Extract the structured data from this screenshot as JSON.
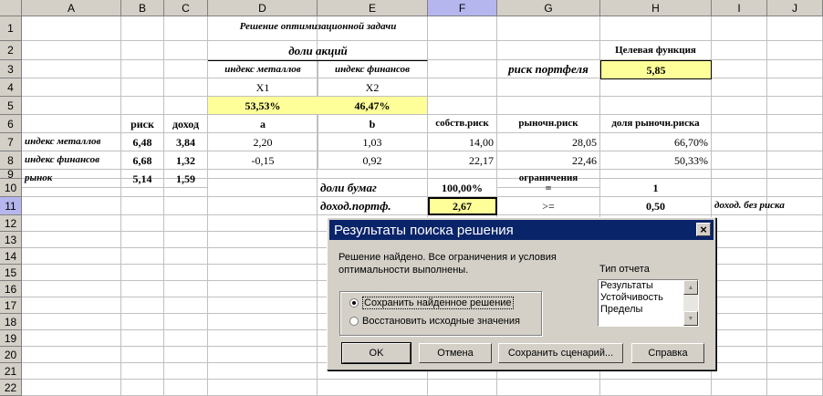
{
  "columns": [
    "A",
    "B",
    "C",
    "D",
    "E",
    "F",
    "G",
    "H",
    "I",
    "J"
  ],
  "rows": [
    "1",
    "2",
    "3",
    "4",
    "5",
    "6",
    "7",
    "8",
    "9",
    "10",
    "11",
    "12",
    "13",
    "14",
    "15",
    "16",
    "17",
    "18",
    "19",
    "20",
    "21",
    "22"
  ],
  "cells": {
    "title": "Решение  оптимизационной задачи",
    "shares_header": "доли акций",
    "target_function": "Целевая функция",
    "metals_index_head": "индекс металлов",
    "finance_index_head": "индекс финансов",
    "portfolio_risk_label": "риск портфеля",
    "portfolio_risk_value": "5,85",
    "x1": "X1",
    "x2": "X2",
    "x1_value": "53,53%",
    "x2_value": "46,47%",
    "risk_head": "риск",
    "income_head": "доход",
    "a_head": "a",
    "b_head": "b",
    "own_risk_head": "собств.риск",
    "market_risk_head": "рыночн.риск",
    "market_share_head": "доля рыночн.риска",
    "row7": {
      "label": "индекс металлов",
      "risk": "6,48",
      "income": "3,84",
      "a": "2,20",
      "b": "1,03",
      "own": "14,00",
      "market": "28,05",
      "share": "66,70%"
    },
    "row8": {
      "label": "индекс финансов",
      "risk": "6,68",
      "income": "1,32",
      "a": "-0,15",
      "b": "0,92",
      "own": "22,17",
      "market": "22,46",
      "share": "50,33%"
    },
    "row9": {
      "label": "рынок",
      "risk": "5,14",
      "income": "1,59"
    },
    "constraints": "ограничения",
    "shares_papers": "доли бумаг",
    "shares_papers_value": "100,00%",
    "eq": "=",
    "one": "1",
    "portfolio_income": "доход.портф.",
    "portfolio_income_value": "2,67",
    "ge": ">=",
    "riskfree_value": "0,50",
    "riskfree_label": "доход. без риска"
  },
  "dialog": {
    "title": "Результаты поиска решения",
    "close": "×",
    "message_line1": "Решение найдено. Все ограничения и условия",
    "message_line2": "оптимальности выполнены.",
    "report_type_label": "Тип отчета",
    "report_items": [
      "Результаты",
      "Устойчивость",
      "Пределы"
    ],
    "radio_keep": "Сохранить найденное решение",
    "radio_restore": "Восстановить исходные значения",
    "buttons": {
      "ok": "OK",
      "cancel": "Отмена",
      "save_scenario": "Сохранить сценарий...",
      "help": "Справка"
    }
  }
}
